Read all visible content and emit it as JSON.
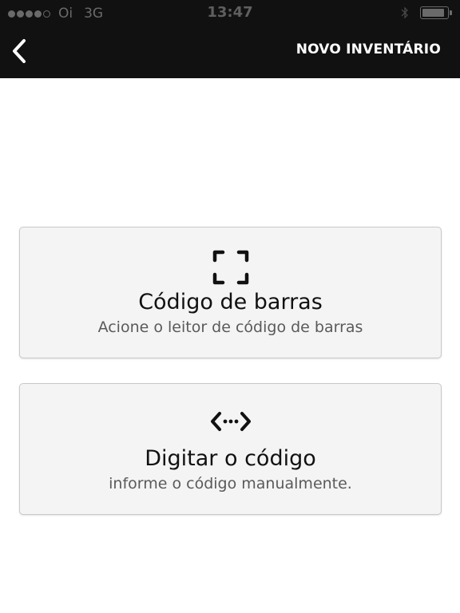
{
  "status_bar": {
    "carrier": "Oi",
    "network": "3G",
    "time": "13:47",
    "signal_bars_filled": 4,
    "signal_bars_total": 5,
    "battery_level": 0.9
  },
  "nav": {
    "title": "NOVO INVENTÁRIO",
    "back_icon": "chevron-left-icon"
  },
  "options": [
    {
      "title": "Código de barras",
      "subtitle": "Acione o leitor de código de barras",
      "icon": "scan-frame-icon"
    },
    {
      "title": "Digitar o código",
      "subtitle": "informe o código manualmente.",
      "icon": "code-input-icon"
    }
  ],
  "colors": {
    "header_bg": "#111111",
    "card_bg": "#f4f4f4",
    "card_border": "#c9c9c9",
    "status_gray": "#6a6a6a"
  }
}
